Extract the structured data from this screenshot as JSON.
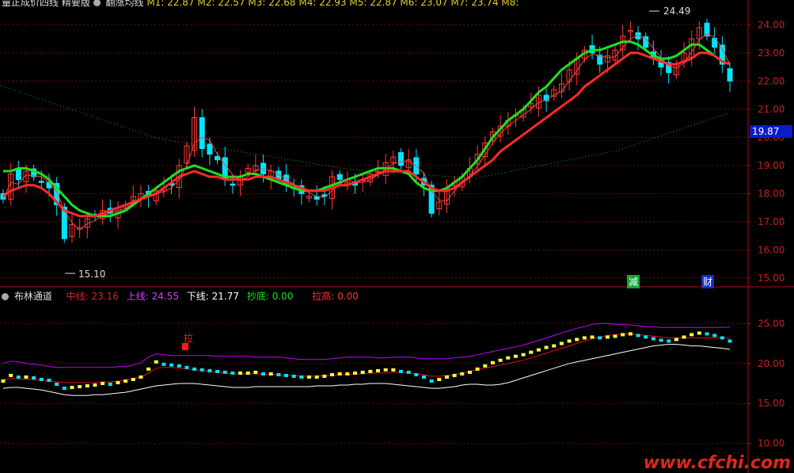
{
  "top_legend": {
    "indicator_name": "量正成价四线 精要版",
    "main_name": "翻涨均线",
    "ma_values": "M1: 22.87  M2: 22.57  M3: 22.68  M4: 22.93  M5: 22.87  M6: 23.07  M7: 23.74  M8:"
  },
  "sub_legend": {
    "title": "布林通道",
    "mid_label": "中线:",
    "mid_value": "23.16",
    "up_label": "上线:",
    "up_value": "24.55",
    "down_label": "下线:",
    "down_value": "21.77",
    "buy_label": "抄底:",
    "buy_value": "0.00",
    "pull_label": "拉高:",
    "pull_value": "0.00"
  },
  "annotations": {
    "high": "24.49",
    "low": "15.10",
    "tag_minus": "减",
    "tag_fin": "财",
    "tag_pull": "拉",
    "current_price": "19.87"
  },
  "watermark": "www.cfchi.com",
  "colors": {
    "up": "#00e5ff",
    "down": "#ff3b3b",
    "ma_fast": "#ff2a2a",
    "ma_mid": "#20e020",
    "boll_up": "#c000ff",
    "boll_mid": "#e01010",
    "boll_low": "#ffffff",
    "yellow": "#ffff40"
  },
  "chart_data": [
    {
      "type": "candlestick",
      "title": "",
      "ylim": [
        14.8,
        24.6
      ],
      "yticks": [
        "24.00",
        "23.00",
        "22.00",
        "21.00",
        "20.00",
        "19.00",
        "18.00",
        "17.00",
        "16.00",
        "15.00"
      ],
      "close": [
        17.8,
        18.7,
        18.5,
        18.8,
        18.6,
        18.4,
        18.2,
        17.6,
        16.4,
        16.9,
        16.8,
        17.1,
        17.2,
        17.4,
        17.3,
        17.5,
        17.6,
        17.9,
        18.0,
        17.9,
        18.1,
        18.2,
        18.3,
        19.0,
        19.7,
        20.7,
        19.6,
        19.4,
        19.2,
        18.5,
        18.3,
        18.6,
        18.9,
        19.0,
        18.7,
        18.8,
        18.5,
        18.3,
        18.2,
        18.0,
        17.9,
        17.8,
        17.9,
        18.6,
        18.5,
        18.4,
        18.3,
        18.5,
        18.7,
        18.8,
        19.1,
        19.3,
        19.0,
        19.2,
        18.7,
        18.3,
        17.3,
        17.7,
        18.2,
        18.4,
        18.6,
        18.9,
        19.4,
        19.8,
        20.2,
        20.4,
        20.6,
        20.8,
        21.0,
        21.2,
        21.5,
        21.3,
        21.7,
        21.9,
        22.4,
        22.8,
        23.1,
        23.0,
        22.6,
        22.9,
        23.1,
        23.6,
        23.8,
        23.5,
        23.2,
        22.8,
        22.5,
        22.3,
        22.6,
        23.0,
        23.5,
        23.9,
        23.6,
        23.2,
        22.6,
        22.0
      ],
      "ma_red": [
        17.9,
        18.1,
        18.2,
        18.3,
        18.3,
        18.2,
        18.0,
        17.7,
        17.4,
        17.3,
        17.2,
        17.2,
        17.2,
        17.3,
        17.4,
        17.5,
        17.6,
        17.7,
        17.8,
        17.9,
        18.0,
        18.2,
        18.4,
        18.6,
        18.7,
        18.8,
        18.7,
        18.6,
        18.6,
        18.5,
        18.5,
        18.5,
        18.5,
        18.6,
        18.6,
        18.6,
        18.5,
        18.4,
        18.3,
        18.2,
        18.1,
        18.1,
        18.1,
        18.2,
        18.3,
        18.3,
        18.4,
        18.5,
        18.6,
        18.7,
        18.8,
        18.8,
        18.8,
        18.8,
        18.6,
        18.4,
        18.2,
        18.1,
        18.1,
        18.2,
        18.4,
        18.6,
        18.8,
        19.0,
        19.2,
        19.5,
        19.7,
        19.9,
        20.1,
        20.3,
        20.5,
        20.7,
        20.9,
        21.1,
        21.3,
        21.5,
        21.8,
        22.0,
        22.2,
        22.4,
        22.6,
        22.8,
        23.0,
        23.0,
        22.9,
        22.8,
        22.7,
        22.6,
        22.6,
        22.7,
        22.8,
        23.0,
        23.0,
        22.9,
        22.7,
        22.6
      ],
      "ma_green": [
        18.8,
        18.8,
        18.9,
        18.9,
        18.8,
        18.7,
        18.5,
        18.2,
        17.9,
        17.6,
        17.4,
        17.3,
        17.2,
        17.2,
        17.2,
        17.3,
        17.4,
        17.6,
        17.8,
        18.0,
        18.2,
        18.4,
        18.6,
        18.8,
        18.9,
        19.0,
        18.9,
        18.8,
        18.7,
        18.6,
        18.6,
        18.6,
        18.7,
        18.7,
        18.6,
        18.5,
        18.4,
        18.3,
        18.2,
        18.1,
        18.1,
        18.1,
        18.2,
        18.3,
        18.4,
        18.5,
        18.6,
        18.7,
        18.8,
        18.9,
        18.9,
        18.9,
        18.8,
        18.7,
        18.4,
        18.2,
        18.1,
        18.1,
        18.2,
        18.4,
        18.6,
        18.9,
        19.2,
        19.6,
        20.0,
        20.3,
        20.6,
        20.8,
        21.0,
        21.3,
        21.6,
        21.8,
        22.1,
        22.4,
        22.6,
        22.8,
        23.0,
        23.1,
        23.1,
        23.2,
        23.3,
        23.4,
        23.4,
        23.3,
        23.1,
        22.9,
        22.8,
        22.8,
        22.9,
        23.1,
        23.3,
        23.3,
        23.1,
        22.9,
        22.7,
        22.6
      ]
    },
    {
      "type": "line",
      "title": "布林通道",
      "ylim": [
        7.0,
        28.0
      ],
      "yticks": [
        "25.00",
        "20.00",
        "15.00",
        "10.00"
      ],
      "series": [
        {
          "name": "上线",
          "values": [
            20.0,
            20.3,
            20.2,
            20.0,
            19.9,
            19.8,
            19.6,
            19.5,
            19.5,
            19.5,
            19.5,
            19.5,
            19.5,
            19.5,
            19.5,
            19.6,
            19.6,
            19.8,
            20.1,
            20.8,
            21.2,
            21.1,
            21.0,
            21.0,
            21.0,
            21.0,
            21.0,
            21.0,
            20.9,
            20.9,
            20.9,
            20.9,
            20.9,
            20.8,
            20.8,
            20.8,
            20.8,
            20.7,
            20.6,
            20.5,
            20.5,
            20.5,
            20.5,
            20.6,
            20.7,
            20.8,
            20.8,
            20.8,
            20.8,
            20.7,
            20.7,
            20.8,
            20.8,
            20.8,
            20.7,
            20.6,
            20.6,
            20.6,
            20.6,
            20.7,
            20.8,
            20.9,
            21.1,
            21.3,
            21.5,
            21.7,
            21.9,
            22.1,
            22.3,
            22.6,
            22.9,
            23.2,
            23.5,
            23.8,
            24.1,
            24.4,
            24.6,
            24.9,
            25.0,
            25.0,
            24.9,
            24.9,
            24.8,
            24.7,
            24.6,
            24.6,
            24.5,
            24.5,
            24.5,
            24.5,
            24.5,
            24.5,
            24.5,
            24.5,
            24.5,
            24.55
          ]
        },
        {
          "name": "中线",
          "values": [
            18.0,
            18.1,
            18.1,
            18.0,
            18.0,
            17.9,
            17.8,
            17.7,
            17.6,
            17.6,
            17.6,
            17.6,
            17.6,
            17.7,
            17.7,
            17.8,
            17.9,
            18.1,
            18.3,
            18.8,
            19.4,
            19.5,
            19.5,
            19.4,
            19.3,
            19.2,
            19.1,
            19.0,
            18.9,
            18.8,
            18.7,
            18.7,
            18.7,
            18.7,
            18.6,
            18.6,
            18.6,
            18.5,
            18.5,
            18.4,
            18.4,
            18.4,
            18.5,
            18.5,
            18.6,
            18.6,
            18.7,
            18.7,
            18.8,
            18.8,
            18.8,
            18.9,
            18.9,
            18.8,
            18.7,
            18.6,
            18.4,
            18.4,
            18.5,
            18.6,
            18.8,
            19.0,
            19.2,
            19.4,
            19.6,
            19.8,
            20.0,
            20.2,
            20.4,
            20.7,
            21.0,
            21.3,
            21.6,
            21.9,
            22.2,
            22.5,
            22.8,
            23.1,
            23.3,
            23.5,
            23.6,
            23.7,
            23.7,
            23.6,
            23.5,
            23.4,
            23.3,
            23.2,
            23.2,
            23.2,
            23.2,
            23.2,
            23.2,
            23.2,
            23.2,
            23.16
          ]
        },
        {
          "name": "下线",
          "values": [
            16.9,
            17.0,
            17.0,
            16.9,
            16.8,
            16.7,
            16.5,
            16.3,
            16.1,
            16.0,
            16.0,
            16.0,
            16.1,
            16.1,
            16.2,
            16.3,
            16.4,
            16.6,
            16.8,
            17.0,
            17.2,
            17.3,
            17.4,
            17.5,
            17.5,
            17.5,
            17.4,
            17.3,
            17.2,
            17.1,
            17.0,
            17.0,
            17.0,
            17.1,
            17.1,
            17.1,
            17.1,
            17.1,
            17.1,
            17.1,
            17.1,
            17.2,
            17.2,
            17.2,
            17.3,
            17.3,
            17.4,
            17.4,
            17.5,
            17.5,
            17.5,
            17.4,
            17.3,
            17.2,
            17.1,
            17.0,
            16.9,
            16.9,
            17.0,
            17.1,
            17.3,
            17.4,
            17.4,
            17.3,
            17.3,
            17.4,
            17.6,
            17.9,
            18.2,
            18.5,
            18.8,
            19.1,
            19.4,
            19.7,
            20.0,
            20.2,
            20.4,
            20.6,
            20.8,
            21.0,
            21.2,
            21.4,
            21.6,
            21.8,
            22.0,
            22.2,
            22.3,
            22.4,
            22.4,
            22.3,
            22.2,
            22.2,
            22.1,
            22.0,
            21.9,
            21.77
          ]
        }
      ],
      "markers_close": [
        17.8,
        18.5,
        18.3,
        18.3,
        18.2,
        18.0,
        17.9,
        17.4,
        16.9,
        17.0,
        17.1,
        17.2,
        17.3,
        17.5,
        17.4,
        17.6,
        17.8,
        18.0,
        18.3,
        19.3,
        20.2,
        19.9,
        19.8,
        19.7,
        19.5,
        19.3,
        19.2,
        19.1,
        19.0,
        18.9,
        18.8,
        18.8,
        18.8,
        18.9,
        18.7,
        18.7,
        18.6,
        18.5,
        18.4,
        18.3,
        18.3,
        18.3,
        18.4,
        18.6,
        18.7,
        18.7,
        18.8,
        18.9,
        19.0,
        19.1,
        19.2,
        19.2,
        19.0,
        18.9,
        18.6,
        18.3,
        17.8,
        18.0,
        18.3,
        18.5,
        18.7,
        18.9,
        19.3,
        19.7,
        20.1,
        20.4,
        20.7,
        20.9,
        21.1,
        21.4,
        21.7,
        22.0,
        22.2,
        22.5,
        22.8,
        23.0,
        23.2,
        23.3,
        23.2,
        23.3,
        23.4,
        23.6,
        23.7,
        23.5,
        23.3,
        23.1,
        22.9,
        22.8,
        23.0,
        23.3,
        23.6,
        23.8,
        23.7,
        23.5,
        23.2,
        22.8
      ]
    }
  ]
}
